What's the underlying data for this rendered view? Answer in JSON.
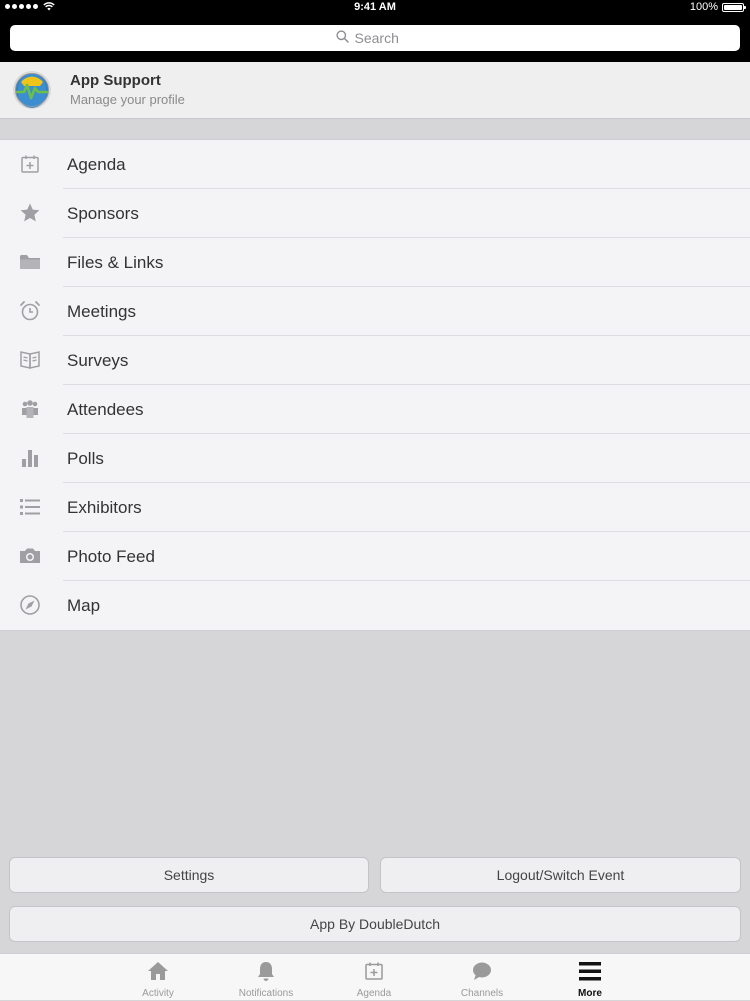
{
  "status_bar": {
    "time": "9:41 AM",
    "battery": "100%"
  },
  "search": {
    "placeholder": "Search"
  },
  "profile": {
    "name": "App Support",
    "subtitle": "Manage your profile"
  },
  "menu": {
    "items": [
      {
        "label": "Agenda",
        "icon": "calendar-add-icon"
      },
      {
        "label": "Sponsors",
        "icon": "star-icon"
      },
      {
        "label": "Files & Links",
        "icon": "folder-icon"
      },
      {
        "label": "Meetings",
        "icon": "alarm-clock-icon"
      },
      {
        "label": "Surveys",
        "icon": "open-book-icon"
      },
      {
        "label": "Attendees",
        "icon": "people-icon"
      },
      {
        "label": "Polls",
        "icon": "bar-chart-icon"
      },
      {
        "label": "Exhibitors",
        "icon": "list-icon"
      },
      {
        "label": "Photo Feed",
        "icon": "camera-icon"
      },
      {
        "label": "Map",
        "icon": "compass-icon"
      }
    ]
  },
  "buttons": {
    "settings": "Settings",
    "logout": "Logout/Switch Event",
    "credit": "App By DoubleDutch"
  },
  "tabs": [
    {
      "label": "Activity",
      "icon": "home-icon",
      "active": false
    },
    {
      "label": "Notifications",
      "icon": "bell-icon",
      "active": false
    },
    {
      "label": "Agenda",
      "icon": "calendar-add-icon",
      "active": false
    },
    {
      "label": "Channels",
      "icon": "chat-bubble-icon",
      "active": false
    },
    {
      "label": "More",
      "icon": "menu-icon",
      "active": true
    }
  ],
  "colors": {
    "header_bg": "#000000",
    "background": "#d6d6d8",
    "list_bg": "#f4f4f6",
    "icon_gray": "#a0a0a4",
    "active_tab": "#111111"
  }
}
